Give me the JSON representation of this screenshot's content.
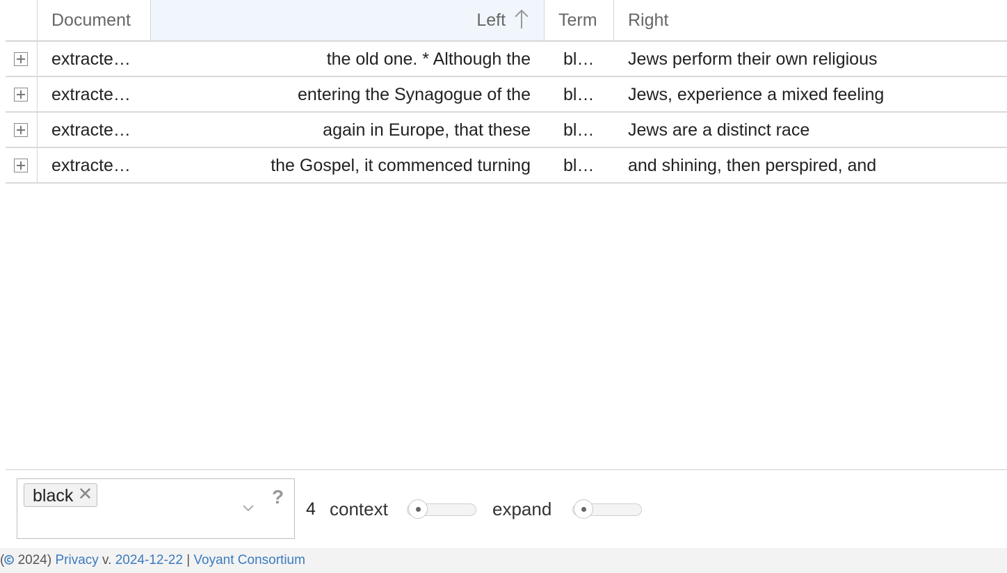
{
  "grid": {
    "columns": {
      "document": "Document",
      "left": "Left",
      "term": "Term",
      "right": "Right"
    },
    "sorted_column": "left",
    "rows": [
      {
        "document": "extracte…",
        "left": "the old one. * Although the",
        "term": "bl…",
        "right": "Jews perform their own religious"
      },
      {
        "document": "extracte…",
        "left": "entering the Synagogue of the",
        "term": "bl…",
        "right": "Jews, experience a mixed feeling"
      },
      {
        "document": "extracte…",
        "left": "again in Europe, that these",
        "term": "bl…",
        "right": "Jews are a distinct race"
      },
      {
        "document": "extracte…",
        "left": "the Gospel, it commenced turning",
        "term": "bl…",
        "right": "and shining, then perspired, and"
      }
    ]
  },
  "toolbar": {
    "tag": "black",
    "tag_remove": "✕",
    "help": "?",
    "count": "4",
    "context_label": "context",
    "expand_label": "expand",
    "context_level": 0.1,
    "expand_level": 0.1
  },
  "footer": {
    "prefix": "(",
    "year": " 2024) ",
    "privacy": "Privacy",
    "version_prefix": " v. ",
    "version": "2024-12-22",
    "sep": " | ",
    "consortium": "Voyant Consortium"
  },
  "icons": {
    "sort": "arrow-up-icon",
    "expander": "plus-box-icon",
    "dropdown": "chevron-down-icon",
    "copyright": "copyright-icon"
  },
  "colors": {
    "link": "#3a7bbf",
    "sorted_header_bg": "#f0f6fb",
    "footer_bg": "#f3f3f3"
  }
}
